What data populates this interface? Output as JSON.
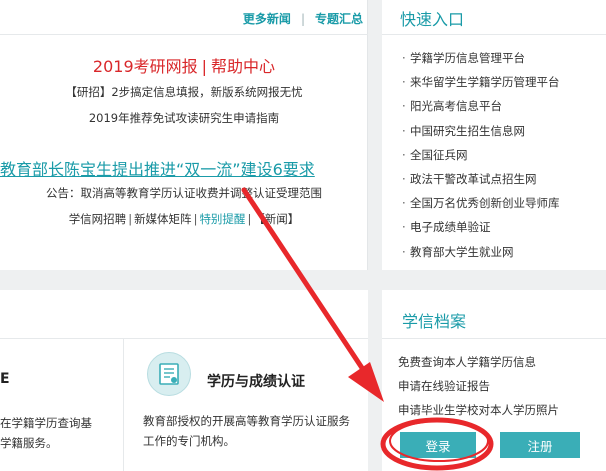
{
  "news": {
    "more_news": "更多新闻",
    "separator": "|",
    "topics": "专题汇总",
    "headline_red_a": "2019考研网报",
    "headline_red_b": "帮助中心",
    "line1": "【研招】2步搞定信息填报，新版系统网报无忧",
    "line2": "2019年推荐免试攻读研究生申请指南",
    "headline_teal": "教育部长陈宝生提出推进“双一流”建设6要求",
    "line3": "公告：取消高等教育学历认证收费并调整认证受理范围",
    "line4_a": "学信网招聘",
    "line4_b": "新媒体矩阵",
    "line4_c": "特别提醒",
    "line4_d": "【新闻】"
  },
  "quick_entry": {
    "title": "快速入口",
    "bullet": "·",
    "items": [
      "学籍学历信息管理平台",
      "来华留学生学籍学历管理平台",
      "阳光高考信息平台",
      "中国研究生招生信息网",
      "全国征兵网",
      "政法干警改革试点招生网",
      "全国万名优秀创新创业导师库",
      "电子成绩单验证",
      "教育部大学生就业网"
    ]
  },
  "services": {
    "left_title": "E",
    "left_desc_1": "在学籍学历查询基",
    "left_desc_2": "学籍服务。",
    "right_title": "学历与成绩认证",
    "right_desc_1": "教育部授权的开展高等教育学历认证服务",
    "right_desc_2": "工作的专门机构。"
  },
  "archive": {
    "title": "学信档案",
    "items": [
      "免费查询本人学籍学历信息",
      "申请在线验证报告",
      "申请毕业生学校对本人学历照片"
    ],
    "login": "登录",
    "register": "注册"
  },
  "colors": {
    "accent": "#1a9ba8",
    "button": "#3aaeb7",
    "red": "#d9272a",
    "annotation": "#e8282b"
  }
}
